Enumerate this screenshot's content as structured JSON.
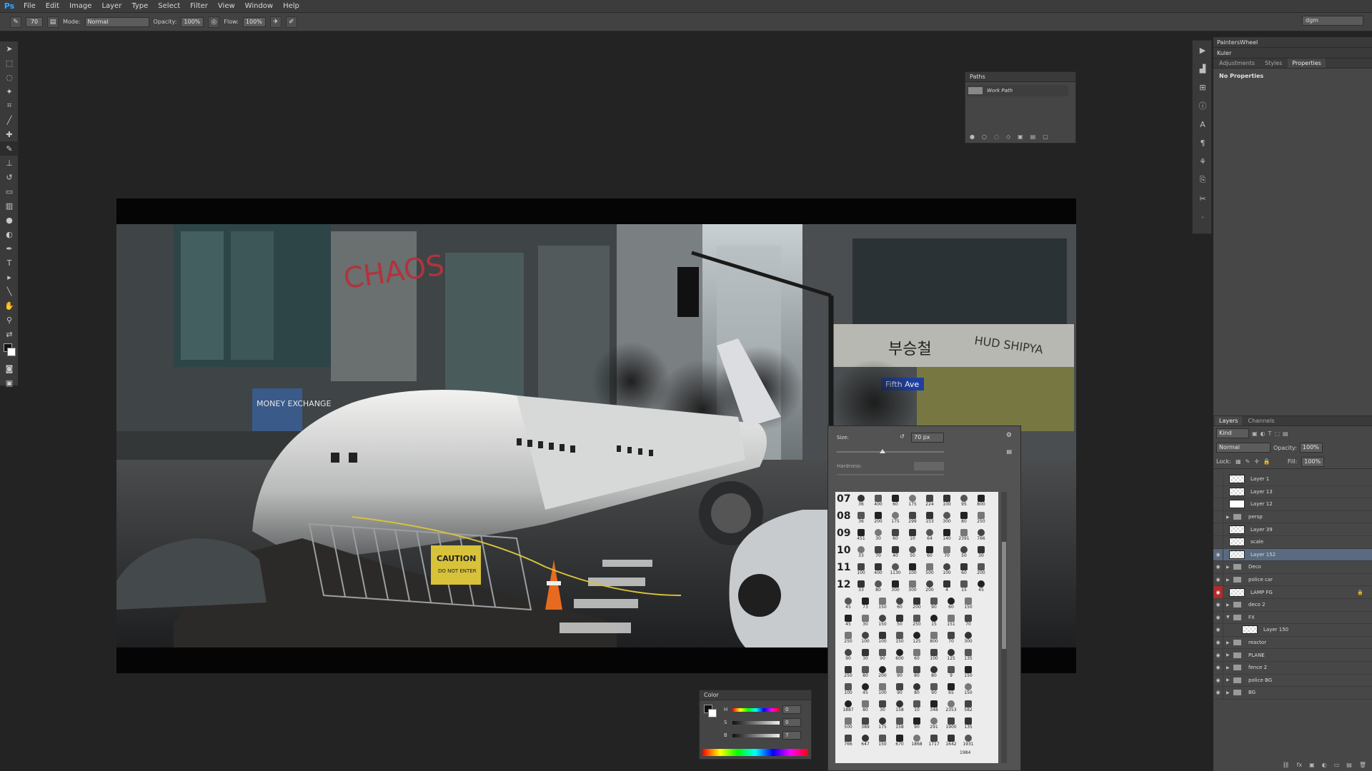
{
  "app": {
    "logo": "Ps"
  },
  "menu": [
    "File",
    "Edit",
    "Image",
    "Layer",
    "Type",
    "Select",
    "Filter",
    "View",
    "Window",
    "Help"
  ],
  "options": {
    "brush_size": "70",
    "mode_label": "Mode:",
    "mode_value": "Normal",
    "opacity_label": "Opacity:",
    "opacity_value": "100%",
    "flow_label": "Flow:",
    "flow_value": "100%"
  },
  "workspace": "dgm",
  "paths_panel": {
    "title": "Paths",
    "item": "Work Path"
  },
  "right_panels": {
    "top1": "PaintersWheel",
    "top2": "Kuler",
    "tabs": [
      "Adjustments",
      "Styles",
      "Properties"
    ],
    "active_tab": "Properties",
    "properties_text": "No Properties"
  },
  "layers_panel": {
    "tabs": [
      "Layers",
      "Channels"
    ],
    "kind_label": "Kind",
    "blend_mode": "Normal",
    "opacity_label": "Opacity:",
    "opacity_value": "100%",
    "lock_label": "Lock:",
    "fill_label": "Fill:",
    "fill_value": "100%",
    "layers": [
      {
        "name": "Layer 1",
        "type": "layer",
        "visible": false
      },
      {
        "name": "Layer 13",
        "type": "layer",
        "visible": false
      },
      {
        "name": "Layer 12",
        "type": "white",
        "visible": false
      },
      {
        "name": "persp",
        "type": "group",
        "visible": false
      },
      {
        "name": "Layer 39",
        "type": "layer",
        "visible": false
      },
      {
        "name": "scale",
        "type": "layer",
        "visible": false
      },
      {
        "name": "Layer 152",
        "type": "layer",
        "visible": true,
        "selected": true
      },
      {
        "name": "Deco",
        "type": "group",
        "visible": true
      },
      {
        "name": "police car",
        "type": "group",
        "visible": true
      },
      {
        "name": "LAMP FG",
        "type": "layer",
        "visible": true,
        "red": true,
        "locked": true
      },
      {
        "name": "deco 2",
        "type": "group",
        "visible": true
      },
      {
        "name": "FX",
        "type": "group-open",
        "visible": true
      },
      {
        "name": "Layer 150",
        "type": "child",
        "visible": true
      },
      {
        "name": "reactor",
        "type": "group",
        "visible": true
      },
      {
        "name": "PLANE",
        "type": "group",
        "visible": true
      },
      {
        "name": "fence 2",
        "type": "group",
        "visible": true
      },
      {
        "name": "police BG",
        "type": "group",
        "visible": true
      },
      {
        "name": "BG",
        "type": "group",
        "visible": true
      }
    ]
  },
  "brush_picker": {
    "size_label": "Size:",
    "size_value": "70 px",
    "hardness_label": "Hardness:",
    "row_numbers": [
      "07",
      "08",
      "09",
      "10",
      "11",
      "12"
    ],
    "rows": [
      [
        "36",
        "400",
        "60",
        "175",
        "224",
        "100",
        "95",
        "800"
      ],
      [
        "36",
        "200",
        "175",
        "299",
        "153",
        "300",
        "80",
        "250"
      ],
      [
        "451",
        "30",
        "60",
        "10",
        "64",
        "140",
        "2391",
        "766"
      ],
      [
        "33",
        "70",
        "40",
        "50",
        "60",
        "70",
        "50",
        "30"
      ],
      [
        "100",
        "400",
        "1130",
        "100",
        "500",
        "100",
        "60",
        "200"
      ],
      [
        "33",
        "80",
        "300",
        "300",
        "200",
        "4",
        "15",
        "45"
      ],
      [
        "45",
        "73",
        "150",
        "60",
        "200",
        "90",
        "60",
        "150"
      ],
      [
        "45",
        "30",
        "150",
        "50",
        "250",
        "15",
        "151",
        "70"
      ],
      [
        "250",
        "100",
        "100",
        "150",
        "125",
        "800",
        "70",
        "300"
      ],
      [
        "90",
        "30",
        "90",
        "600",
        "60",
        "100",
        "125",
        "135"
      ],
      [
        "250",
        "80",
        "200",
        "90",
        "80",
        "80",
        "9",
        "150"
      ],
      [
        "100",
        "45",
        "100",
        "90",
        "80",
        "90",
        "65",
        "150"
      ],
      [
        "1887",
        "80",
        "30",
        "158",
        "10",
        "348",
        "2353",
        "582"
      ],
      [
        "500",
        "389",
        "175",
        "158",
        "90",
        "291",
        "1900",
        "135"
      ],
      [
        "766",
        "647",
        "150",
        "670",
        "1868",
        "1717",
        "1642",
        "1931"
      ]
    ],
    "tail_rows": [
      "1984"
    ]
  },
  "color_panel": {
    "title": "Color",
    "channels": [
      {
        "label": "H",
        "value": "0"
      },
      {
        "label": "S",
        "value": "0"
      },
      {
        "label": "B",
        "value": "7"
      }
    ]
  },
  "painting": {
    "graffiti": "CHAOS",
    "shop_sign": "MONEY EXCHANGE",
    "caution": "CAUTION",
    "caution_sub": "DO NOT ENTER",
    "street_sign": "Fifth Ave",
    "korean_sign": "부승철",
    "banner": "HUD SHIPYA"
  },
  "colors": {
    "accent_blue": "#31a8ff",
    "layer_selected": "#5a6a80",
    "lock_red": "#b22b2b"
  }
}
